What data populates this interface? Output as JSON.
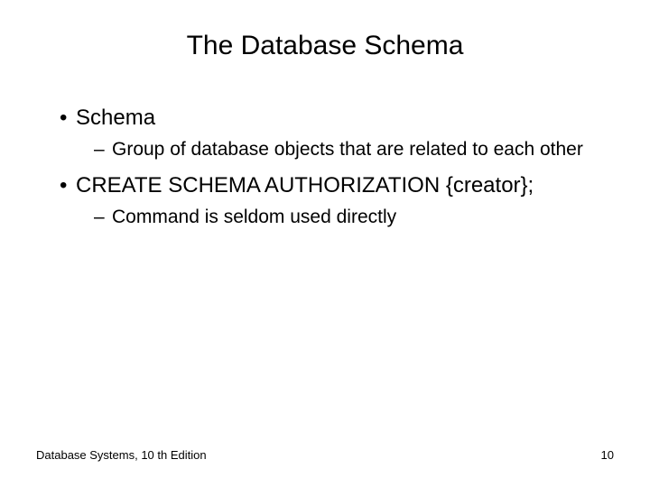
{
  "title": "The Database Schema",
  "bullets": [
    {
      "text": "Schema",
      "sub": [
        "Group of database objects that are related to each other"
      ]
    },
    {
      "text": "CREATE SCHEMA AUTHORIZATION {creator};",
      "sub": [
        "Command is seldom used directly"
      ]
    }
  ],
  "footer": {
    "left": "Database Systems, 10 th Edition",
    "right": "10"
  }
}
